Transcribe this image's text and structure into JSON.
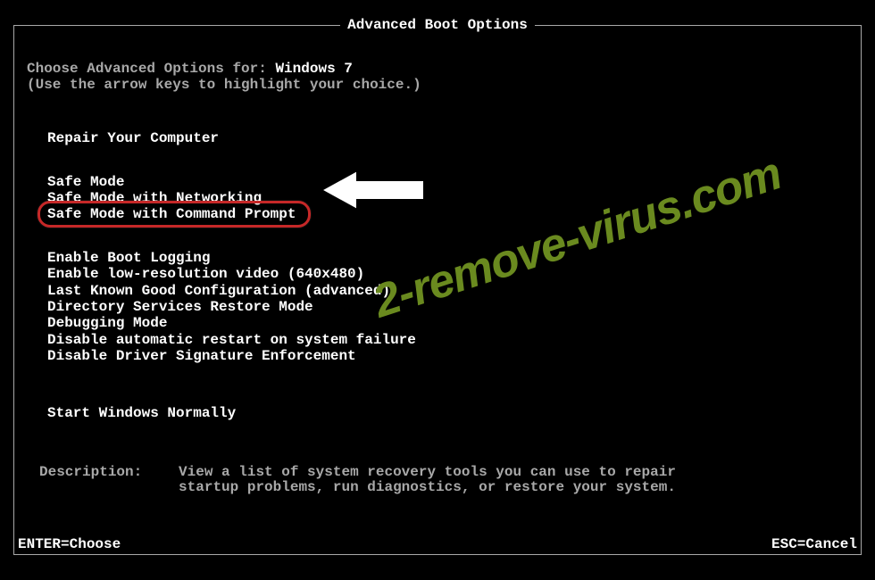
{
  "header": {
    "title": "Advanced Boot Options"
  },
  "intro": {
    "choose_label": "Choose Advanced Options for: ",
    "os_name": "Windows 7",
    "hint": "(Use the arrow keys to highlight your choice.)"
  },
  "groups": {
    "g1": [
      "Repair Your Computer"
    ],
    "g2": [
      "Safe Mode",
      "Safe Mode with Networking",
      "Safe Mode with Command Prompt"
    ],
    "g3": [
      "Enable Boot Logging",
      "Enable low-resolution video (640x480)",
      "Last Known Good Configuration (advanced)",
      "Directory Services Restore Mode",
      "Debugging Mode",
      "Disable automatic restart on system failure",
      "Disable Driver Signature Enforcement"
    ],
    "g4": [
      "Start Windows Normally"
    ]
  },
  "description": {
    "label": "Description:   ",
    "text": "View a list of system recovery tools you can use to repair\nstartup problems, run diagnostics, or restore your system."
  },
  "footer": {
    "enter": "ENTER=Choose",
    "esc": "ESC=Cancel"
  },
  "watermark": "2-remove-virus.com",
  "colors": {
    "red": "#c62828",
    "olive": "#6a8a1f"
  }
}
